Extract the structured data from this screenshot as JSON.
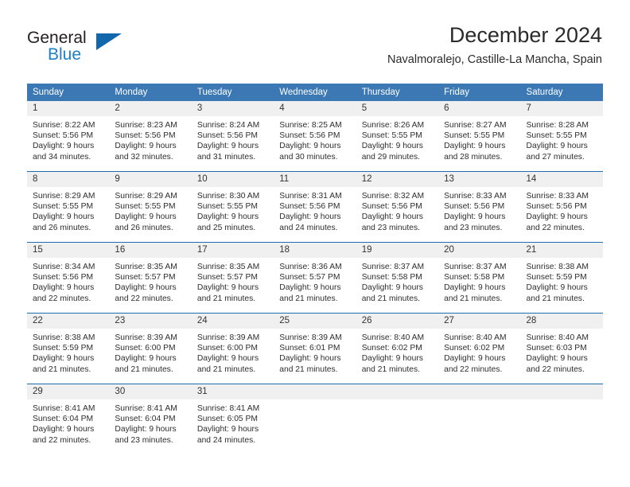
{
  "brand": {
    "name_part1": "General",
    "name_part2": "Blue",
    "triangle_color": "#1266ac",
    "blue_color": "#1f7ec4"
  },
  "header": {
    "month_title": "December 2024",
    "location": "Navalmoralejo, Castille-La Mancha, Spain"
  },
  "theme": {
    "header_blue": "#3b78b4",
    "separator_blue": "#1f6cb0",
    "daynum_band": "#f0f0f0",
    "text": "#2e2e2e"
  },
  "calendar": {
    "weekday_headers": [
      "Sunday",
      "Monday",
      "Tuesday",
      "Wednesday",
      "Thursday",
      "Friday",
      "Saturday"
    ],
    "weeks": [
      [
        {
          "day": "1",
          "sunrise": "Sunrise: 8:22 AM",
          "sunset": "Sunset: 5:56 PM",
          "daylight_line1": "Daylight: 9 hours",
          "daylight_line2": "and 34 minutes."
        },
        {
          "day": "2",
          "sunrise": "Sunrise: 8:23 AM",
          "sunset": "Sunset: 5:56 PM",
          "daylight_line1": "Daylight: 9 hours",
          "daylight_line2": "and 32 minutes."
        },
        {
          "day": "3",
          "sunrise": "Sunrise: 8:24 AM",
          "sunset": "Sunset: 5:56 PM",
          "daylight_line1": "Daylight: 9 hours",
          "daylight_line2": "and 31 minutes."
        },
        {
          "day": "4",
          "sunrise": "Sunrise: 8:25 AM",
          "sunset": "Sunset: 5:56 PM",
          "daylight_line1": "Daylight: 9 hours",
          "daylight_line2": "and 30 minutes."
        },
        {
          "day": "5",
          "sunrise": "Sunrise: 8:26 AM",
          "sunset": "Sunset: 5:55 PM",
          "daylight_line1": "Daylight: 9 hours",
          "daylight_line2": "and 29 minutes."
        },
        {
          "day": "6",
          "sunrise": "Sunrise: 8:27 AM",
          "sunset": "Sunset: 5:55 PM",
          "daylight_line1": "Daylight: 9 hours",
          "daylight_line2": "and 28 minutes."
        },
        {
          "day": "7",
          "sunrise": "Sunrise: 8:28 AM",
          "sunset": "Sunset: 5:55 PM",
          "daylight_line1": "Daylight: 9 hours",
          "daylight_line2": "and 27 minutes."
        }
      ],
      [
        {
          "day": "8",
          "sunrise": "Sunrise: 8:29 AM",
          "sunset": "Sunset: 5:55 PM",
          "daylight_line1": "Daylight: 9 hours",
          "daylight_line2": "and 26 minutes."
        },
        {
          "day": "9",
          "sunrise": "Sunrise: 8:29 AM",
          "sunset": "Sunset: 5:55 PM",
          "daylight_line1": "Daylight: 9 hours",
          "daylight_line2": "and 26 minutes."
        },
        {
          "day": "10",
          "sunrise": "Sunrise: 8:30 AM",
          "sunset": "Sunset: 5:55 PM",
          "daylight_line1": "Daylight: 9 hours",
          "daylight_line2": "and 25 minutes."
        },
        {
          "day": "11",
          "sunrise": "Sunrise: 8:31 AM",
          "sunset": "Sunset: 5:56 PM",
          "daylight_line1": "Daylight: 9 hours",
          "daylight_line2": "and 24 minutes."
        },
        {
          "day": "12",
          "sunrise": "Sunrise: 8:32 AM",
          "sunset": "Sunset: 5:56 PM",
          "daylight_line1": "Daylight: 9 hours",
          "daylight_line2": "and 23 minutes."
        },
        {
          "day": "13",
          "sunrise": "Sunrise: 8:33 AM",
          "sunset": "Sunset: 5:56 PM",
          "daylight_line1": "Daylight: 9 hours",
          "daylight_line2": "and 23 minutes."
        },
        {
          "day": "14",
          "sunrise": "Sunrise: 8:33 AM",
          "sunset": "Sunset: 5:56 PM",
          "daylight_line1": "Daylight: 9 hours",
          "daylight_line2": "and 22 minutes."
        }
      ],
      [
        {
          "day": "15",
          "sunrise": "Sunrise: 8:34 AM",
          "sunset": "Sunset: 5:56 PM",
          "daylight_line1": "Daylight: 9 hours",
          "daylight_line2": "and 22 minutes."
        },
        {
          "day": "16",
          "sunrise": "Sunrise: 8:35 AM",
          "sunset": "Sunset: 5:57 PM",
          "daylight_line1": "Daylight: 9 hours",
          "daylight_line2": "and 22 minutes."
        },
        {
          "day": "17",
          "sunrise": "Sunrise: 8:35 AM",
          "sunset": "Sunset: 5:57 PM",
          "daylight_line1": "Daylight: 9 hours",
          "daylight_line2": "and 21 minutes."
        },
        {
          "day": "18",
          "sunrise": "Sunrise: 8:36 AM",
          "sunset": "Sunset: 5:57 PM",
          "daylight_line1": "Daylight: 9 hours",
          "daylight_line2": "and 21 minutes."
        },
        {
          "day": "19",
          "sunrise": "Sunrise: 8:37 AM",
          "sunset": "Sunset: 5:58 PM",
          "daylight_line1": "Daylight: 9 hours",
          "daylight_line2": "and 21 minutes."
        },
        {
          "day": "20",
          "sunrise": "Sunrise: 8:37 AM",
          "sunset": "Sunset: 5:58 PM",
          "daylight_line1": "Daylight: 9 hours",
          "daylight_line2": "and 21 minutes."
        },
        {
          "day": "21",
          "sunrise": "Sunrise: 8:38 AM",
          "sunset": "Sunset: 5:59 PM",
          "daylight_line1": "Daylight: 9 hours",
          "daylight_line2": "and 21 minutes."
        }
      ],
      [
        {
          "day": "22",
          "sunrise": "Sunrise: 8:38 AM",
          "sunset": "Sunset: 5:59 PM",
          "daylight_line1": "Daylight: 9 hours",
          "daylight_line2": "and 21 minutes."
        },
        {
          "day": "23",
          "sunrise": "Sunrise: 8:39 AM",
          "sunset": "Sunset: 6:00 PM",
          "daylight_line1": "Daylight: 9 hours",
          "daylight_line2": "and 21 minutes."
        },
        {
          "day": "24",
          "sunrise": "Sunrise: 8:39 AM",
          "sunset": "Sunset: 6:00 PM",
          "daylight_line1": "Daylight: 9 hours",
          "daylight_line2": "and 21 minutes."
        },
        {
          "day": "25",
          "sunrise": "Sunrise: 8:39 AM",
          "sunset": "Sunset: 6:01 PM",
          "daylight_line1": "Daylight: 9 hours",
          "daylight_line2": "and 21 minutes."
        },
        {
          "day": "26",
          "sunrise": "Sunrise: 8:40 AM",
          "sunset": "Sunset: 6:02 PM",
          "daylight_line1": "Daylight: 9 hours",
          "daylight_line2": "and 21 minutes."
        },
        {
          "day": "27",
          "sunrise": "Sunrise: 8:40 AM",
          "sunset": "Sunset: 6:02 PM",
          "daylight_line1": "Daylight: 9 hours",
          "daylight_line2": "and 22 minutes."
        },
        {
          "day": "28",
          "sunrise": "Sunrise: 8:40 AM",
          "sunset": "Sunset: 6:03 PM",
          "daylight_line1": "Daylight: 9 hours",
          "daylight_line2": "and 22 minutes."
        }
      ],
      [
        {
          "day": "29",
          "sunrise": "Sunrise: 8:41 AM",
          "sunset": "Sunset: 6:04 PM",
          "daylight_line1": "Daylight: 9 hours",
          "daylight_line2": "and 22 minutes."
        },
        {
          "day": "30",
          "sunrise": "Sunrise: 8:41 AM",
          "sunset": "Sunset: 6:04 PM",
          "daylight_line1": "Daylight: 9 hours",
          "daylight_line2": "and 23 minutes."
        },
        {
          "day": "31",
          "sunrise": "Sunrise: 8:41 AM",
          "sunset": "Sunset: 6:05 PM",
          "daylight_line1": "Daylight: 9 hours",
          "daylight_line2": "and 24 minutes."
        },
        {
          "day": "",
          "sunrise": "",
          "sunset": "",
          "daylight_line1": "",
          "daylight_line2": ""
        },
        {
          "day": "",
          "sunrise": "",
          "sunset": "",
          "daylight_line1": "",
          "daylight_line2": ""
        },
        {
          "day": "",
          "sunrise": "",
          "sunset": "",
          "daylight_line1": "",
          "daylight_line2": ""
        },
        {
          "day": "",
          "sunrise": "",
          "sunset": "",
          "daylight_line1": "",
          "daylight_line2": ""
        }
      ]
    ]
  }
}
